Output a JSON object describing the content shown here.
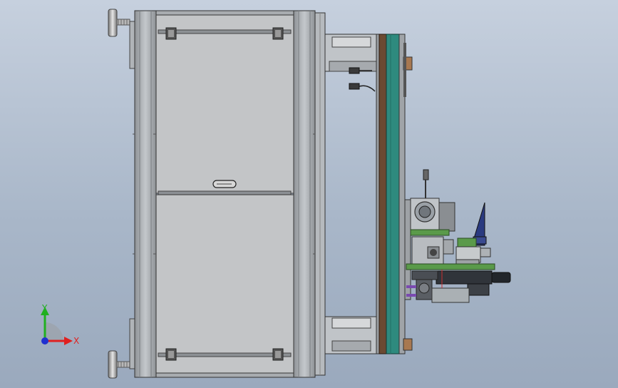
{
  "view": {
    "background_top": "#c6d0de",
    "background_bottom": "#9aa9bd"
  },
  "triad": {
    "x_label": "X",
    "y_label": "Y",
    "x_color": "#e02020",
    "y_color": "#20b020",
    "z_color": "#2030d0"
  },
  "colors": {
    "frame_metal": "#b4b8bc",
    "panel": "#c2c4c6",
    "teal_plate": "#2e8a7e",
    "brown_plate": "#6b4a32",
    "green_board": "#5a9a4a",
    "navy_bracket": "#2a3a80",
    "dark_motor": "#30343a"
  },
  "icons": {
    "triad": "coordinate-axes-icon",
    "leveling_foot": "leveling-foot-icon"
  }
}
